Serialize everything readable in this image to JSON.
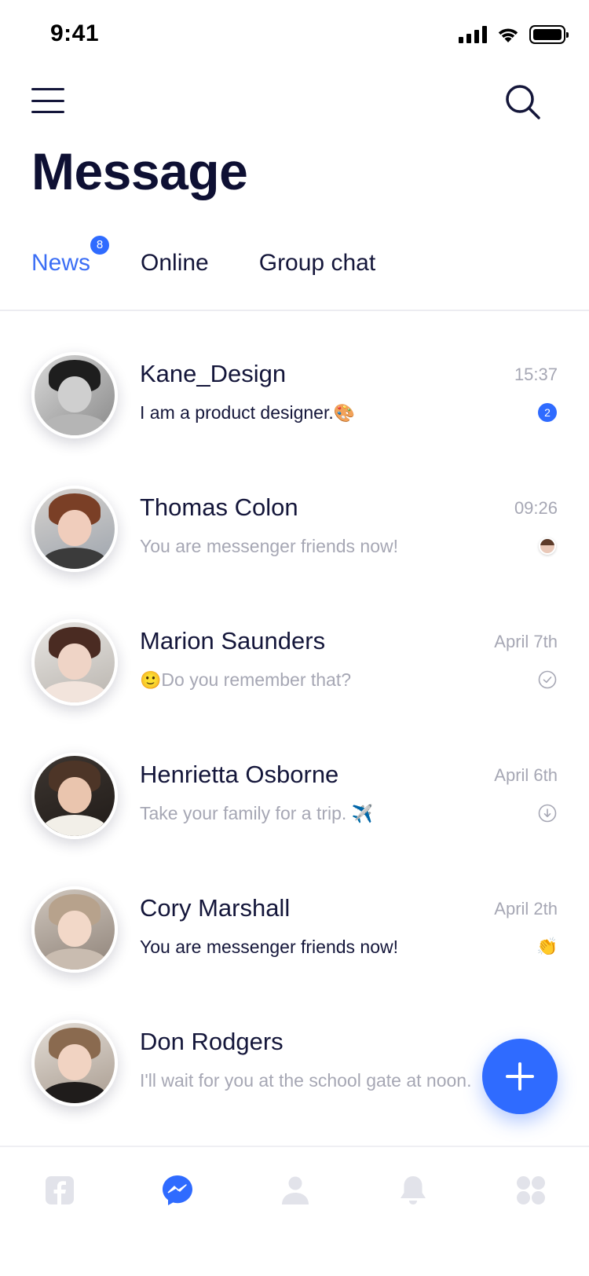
{
  "status_bar": {
    "time": "9:41"
  },
  "header": {
    "title": "Message"
  },
  "tabs": [
    {
      "label": "News",
      "badge": "8",
      "active": true
    },
    {
      "label": "Online",
      "active": false
    },
    {
      "label": "Group chat",
      "active": false
    }
  ],
  "conversations": [
    {
      "name": "Kane_Design",
      "message": "I am a product designer.",
      "emoji": "🎨",
      "time": "15:37",
      "status": "unread",
      "unread_count": "2"
    },
    {
      "name": "Thomas Colon",
      "message": "You are messenger friends now!",
      "emoji": "",
      "time": "09:26",
      "status": "seen-avatar"
    },
    {
      "name": "Marion Saunders",
      "message": "Do you remember that?",
      "emoji_prefix": "🙂",
      "time": "April 7th",
      "status": "delivered-check"
    },
    {
      "name": "Henrietta Osborne",
      "message": "Take your family for a trip.",
      "emoji": "✈️",
      "time": "April 6th",
      "status": "sent-arrow"
    },
    {
      "name": "Cory Marshall",
      "message": "You are messenger friends now!",
      "emoji": "",
      "time": "April 2th",
      "status": "clap-emoji",
      "status_emoji": "👏"
    },
    {
      "name": "Don Rodgers",
      "message": "I'll wait for you at the school gate at noon.",
      "emoji": "",
      "time": "",
      "status": "none"
    }
  ],
  "fab": {
    "icon": "plus-icon"
  },
  "tab_bar": [
    {
      "icon": "facebook-icon",
      "active": false
    },
    {
      "icon": "messenger-icon",
      "active": true
    },
    {
      "icon": "profile-icon",
      "active": false
    },
    {
      "icon": "bell-icon",
      "active": false
    },
    {
      "icon": "apps-icon",
      "active": false
    }
  ],
  "colors": {
    "accent": "#2f6bff",
    "title": "#0e1033",
    "muted": "#a6a7b4",
    "inactive_icon": "#e2e3ea"
  }
}
